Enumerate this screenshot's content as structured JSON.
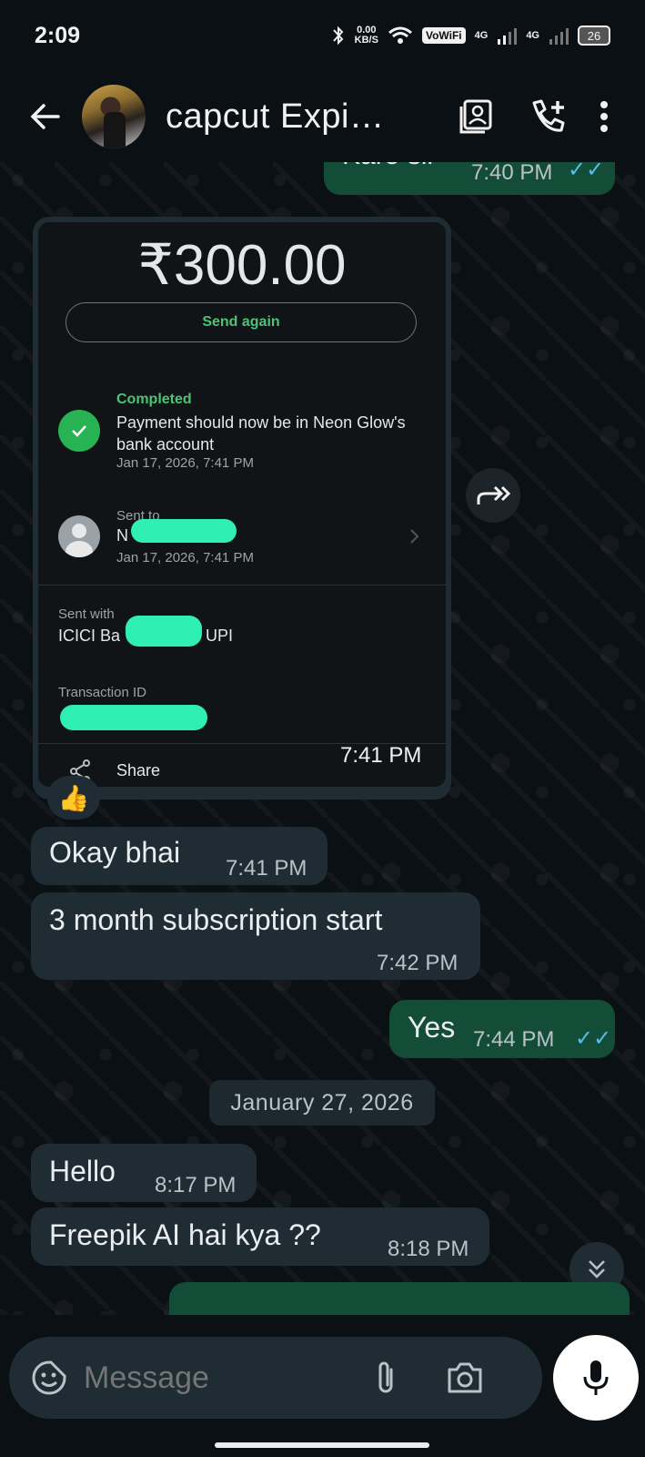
{
  "status_bar": {
    "time": "2:09",
    "speed_value": "0.00",
    "speed_unit": "KB/S",
    "vowifi": "VoWiFi",
    "sim1": "4G",
    "sim2": "4G",
    "battery": "26"
  },
  "header": {
    "title": "capcut Expi…"
  },
  "messages": {
    "m0": {
      "text": "Karo sir",
      "time": "7:40 PM"
    },
    "m2": {
      "text": "Okay bhai",
      "time": "7:41 PM"
    },
    "m3": {
      "text": "3 month subscription start",
      "time": "7:42 PM"
    },
    "m4": {
      "text": "Yes",
      "time": "7:44 PM"
    },
    "m5": {
      "text": "Hello",
      "time": "8:17 PM"
    },
    "m6": {
      "text": "Freepik AI hai kya ??",
      "time": "8:18 PM"
    }
  },
  "card": {
    "amount": "₹300.00",
    "send_again": "Send again",
    "status": "Completed",
    "payment_text": "Payment should now be in Neon Glow's bank account",
    "status_date": "Jan 17, 2026, 7:41 PM",
    "sent_to_label": "Sent to",
    "sent_to_initial": "N",
    "sent_to_date": "Jan 17, 2026, 7:41 PM",
    "sent_with_label": "Sent with",
    "sent_with_prefix": "ICICI Ba",
    "sent_with_suffix": "UPI",
    "transaction_label": "Transaction ID",
    "share": "Share",
    "time": "7:41 PM"
  },
  "reaction": "👍",
  "date_divider": "January 27, 2026",
  "composer": {
    "placeholder": "Message"
  },
  "colors": {
    "incoming": "#202c33",
    "outgoing": "#144d37",
    "accent": "#4cc377",
    "read_tick": "#53bdeb"
  }
}
